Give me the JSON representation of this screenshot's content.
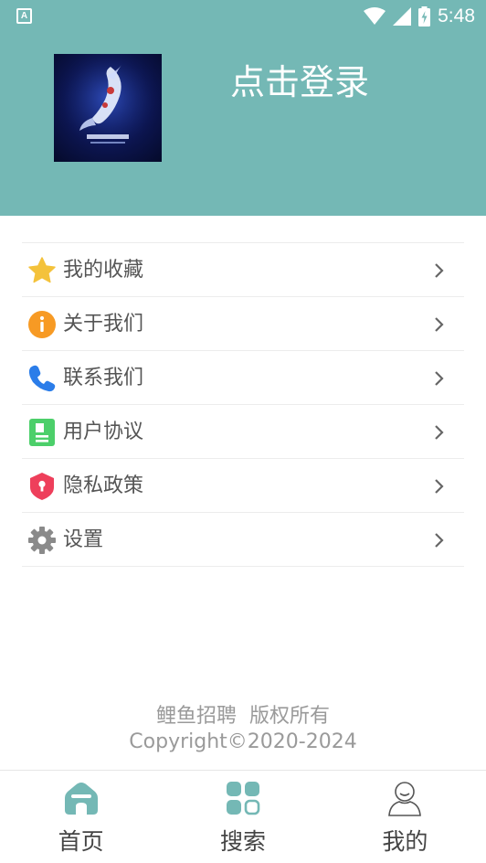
{
  "status_bar": {
    "notification_icon_letter": "A",
    "time": "5:48"
  },
  "header": {
    "login_label": "点击登录",
    "avatar_icon": "koi-fish-logo"
  },
  "menu": [
    {
      "label": "我的收藏",
      "icon": "star-icon"
    },
    {
      "label": "关于我们",
      "icon": "info-icon"
    },
    {
      "label": "联系我们",
      "icon": "phone-icon"
    },
    {
      "label": "用户协议",
      "icon": "document-icon"
    },
    {
      "label": "隐私政策",
      "icon": "shield-icon"
    },
    {
      "label": "设置",
      "icon": "gear-icon"
    }
  ],
  "footer": {
    "line1": "鲤鱼招聘  版权所有",
    "line2": "Copyright©2020-2024"
  },
  "tabs": [
    {
      "label": "首页",
      "icon": "home-icon"
    },
    {
      "label": "搜索",
      "icon": "grid-icon"
    },
    {
      "label": "我的",
      "icon": "user-icon"
    }
  ],
  "colors": {
    "header_bg": "#74b8b5",
    "accent": "#74b8b5"
  }
}
